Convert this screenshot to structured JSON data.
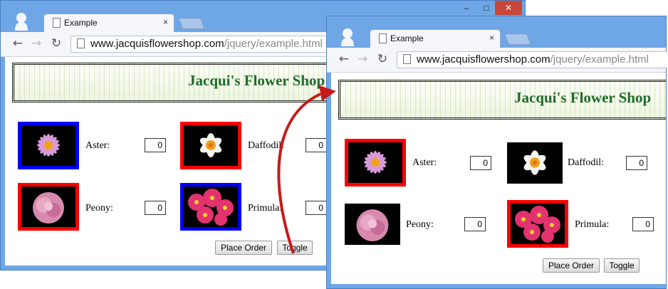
{
  "window_controls": {
    "minimize": "‒",
    "maximize": "□",
    "close": "✕"
  },
  "browser": {
    "tab_title": "Example",
    "tab_close": "×",
    "back_icon": "←",
    "forward_icon": "→",
    "reload_icon": "↻",
    "url_host": "www.jacquisflowershop.com",
    "url_path": "/jquery/example.html"
  },
  "page": {
    "title": "Jacqui's Flower Shop",
    "place_order_label": "Place Order",
    "toggle_label": "Toggle"
  },
  "before": {
    "flowers": [
      {
        "name": "Aster:",
        "qty": "0",
        "border": "#0000ff"
      },
      {
        "name": "Daffodil:",
        "qty": "0",
        "border": "#ff0000"
      },
      {
        "name": "Peony:",
        "qty": "0",
        "border": "#ff0000"
      },
      {
        "name": "Primula:",
        "qty": "0",
        "border": "#0000ff"
      }
    ]
  },
  "after": {
    "flowers": [
      {
        "name": "Aster:",
        "qty": "0",
        "border": "#ff0000"
      },
      {
        "name": "Daffodil:",
        "qty": "0",
        "border": "none"
      },
      {
        "name": "Peony:",
        "qty": "0",
        "border": "none"
      },
      {
        "name": "Primula:",
        "qty": "0",
        "border": "#ff0000"
      }
    ]
  },
  "colors": {
    "accent_arrow": "#c61a1a",
    "title_green": "#1f6b2a",
    "window_frame": "#6fa7e6"
  },
  "icons": {
    "aster": "aster-flower-image",
    "daffodil": "daffodil-flower-image",
    "peony": "peony-flower-image",
    "primula": "primula-flower-image"
  }
}
